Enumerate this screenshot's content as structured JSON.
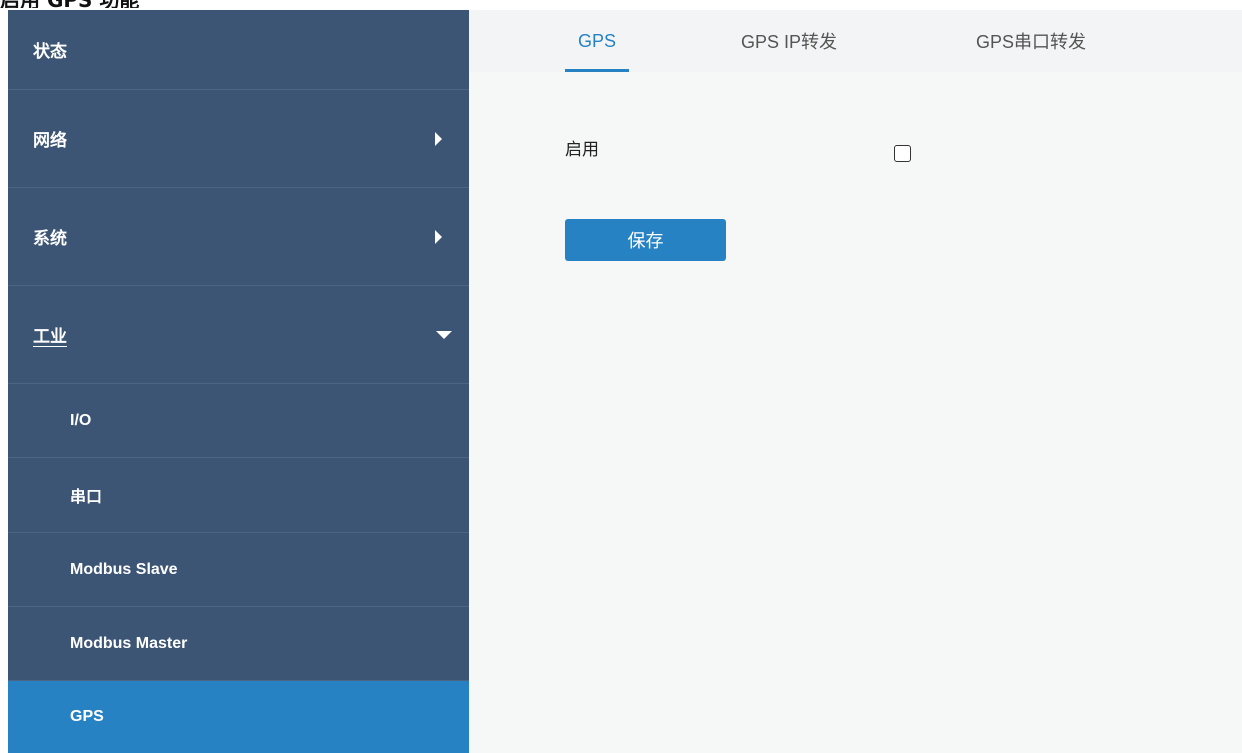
{
  "caption": "启用 GPS 功能",
  "sidebar": {
    "items": [
      {
        "label": "状态"
      },
      {
        "label": "网络"
      },
      {
        "label": "系统"
      },
      {
        "label": "工业"
      },
      {
        "label": "I/O"
      },
      {
        "label": "串口"
      },
      {
        "label": "Modbus Slave"
      },
      {
        "label": "Modbus Master"
      },
      {
        "label": "GPS"
      }
    ],
    "active": "GPS"
  },
  "tabs": [
    {
      "label": "GPS"
    },
    {
      "label": "GPS IP转发"
    },
    {
      "label": "GPS串口转发"
    }
  ],
  "form": {
    "enable_label": "启用",
    "enable_checked": false,
    "save_label": "保存"
  },
  "colors": {
    "sidebar_bg": "#3c5575",
    "accent": "#2782c4",
    "content_bg": "#f6f7f7",
    "tabbar_bg": "#f3f4f5"
  }
}
